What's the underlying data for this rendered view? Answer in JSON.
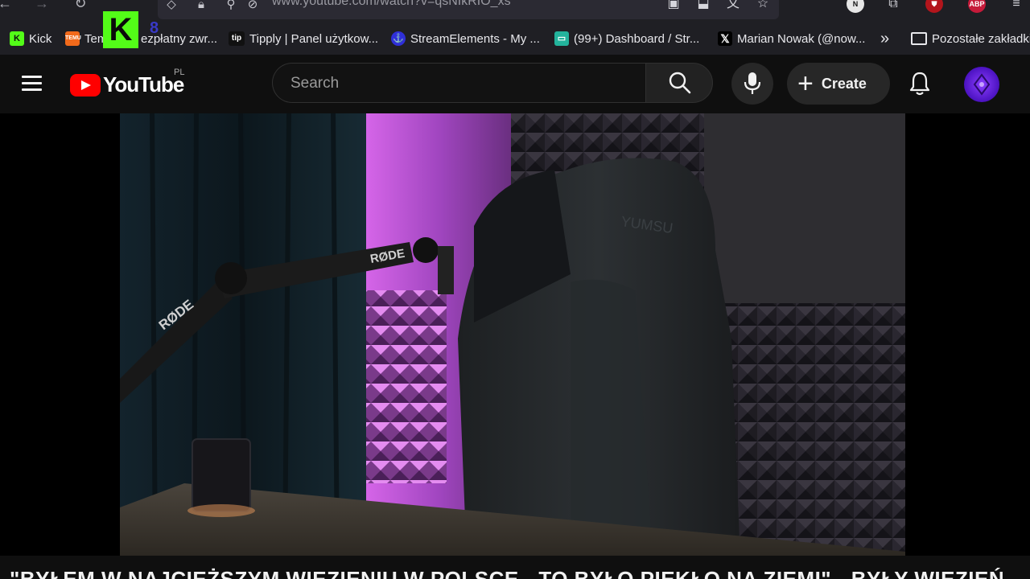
{
  "browser": {
    "url": "www.youtube.com/watch?v=qsNIkRIO_xs"
  },
  "overlay": {
    "kick_letter": "K",
    "kick_badge": "8"
  },
  "bookmarks": [
    {
      "label": "Kick",
      "icon": "kick-icon",
      "color": "#53fc18"
    },
    {
      "label": "Tem",
      "icon": "temu-icon",
      "color": "#f26a1b"
    },
    {
      "label": "ezpłatny zwr...",
      "icon": "",
      "color": ""
    },
    {
      "label": "Tipply | Panel użytkow...",
      "icon": "tipply-icon",
      "color": "#111111"
    },
    {
      "label": "StreamElements - My ...",
      "icon": "streamelements-icon",
      "color": "#2f2fd8"
    },
    {
      "label": "(99+) Dashboard / Str...",
      "icon": "twitch-icon",
      "color": "#23b39c"
    },
    {
      "label": "Marian Nowak (@now...",
      "icon": "x-icon",
      "color": "#000000"
    },
    {
      "label": "Pozostałe zakładki",
      "icon": "folder-icon",
      "color": ""
    }
  ],
  "youtube": {
    "logo_text": "YouTube",
    "country_code": "PL",
    "search_placeholder": "Search",
    "create_label": "Create"
  },
  "video": {
    "title": "\"BYŁEM W NAJCIĘŻSZYM WIĘZIENIU W POLSCE - TO BYŁO PIEKŁO NA ZIEMI\" - BYŁY WIĘZIEŃ",
    "brand_arm": "RØDE",
    "brand_chair": "YUMSU"
  },
  "colors": {
    "youtube_red": "#ff0000",
    "kick_green": "#53fc18",
    "background": "#0f0f0f"
  }
}
